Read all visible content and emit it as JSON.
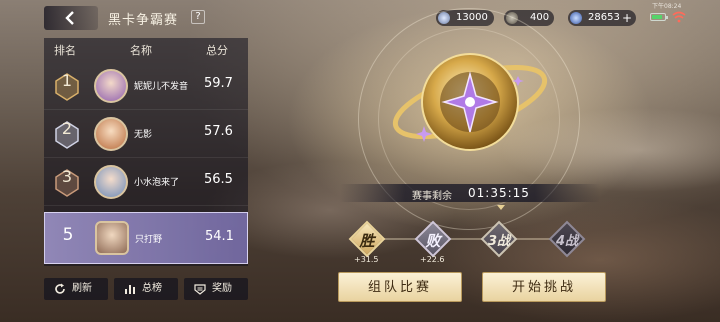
{
  "header": {
    "title": "黑卡争霸赛",
    "help": "?"
  },
  "currencies": [
    {
      "icon": "gem-icon",
      "value": "13000"
    },
    {
      "icon": "card-icon",
      "value": "400"
    },
    {
      "icon": "coin-icon",
      "value": "28653",
      "plus": "+"
    }
  ],
  "status": {
    "time": "下午08:24"
  },
  "board": {
    "headers": {
      "rank": "排名",
      "name": "名称",
      "score": "总分"
    },
    "rows": [
      {
        "rank": "1",
        "name": "妮妮儿不发音",
        "score": "59.7",
        "self": false
      },
      {
        "rank": "2",
        "name": "无影",
        "score": "57.6",
        "self": false
      },
      {
        "rank": "3",
        "name": "小水泡来了",
        "score": "56.5",
        "self": false
      },
      {
        "rank": "5",
        "name": "只打野",
        "score": "54.1",
        "self": true
      }
    ],
    "buttons": {
      "refresh": "刷新",
      "ranking": "总榜",
      "reward": "奖励"
    }
  },
  "timer": {
    "label": "赛事剩余",
    "value": "01:35:15"
  },
  "matches": [
    {
      "label": "胜",
      "points": "+31.5",
      "state": "win"
    },
    {
      "label": "败",
      "points": "+22.6",
      "state": "lose"
    },
    {
      "label": "3战",
      "points": "",
      "state": "pending"
    },
    {
      "label": "4战",
      "points": "",
      "state": "locked"
    }
  ],
  "actions": {
    "team": "组队比赛",
    "challenge": "开始挑战"
  },
  "colors": {
    "accent": "#e9d39a",
    "self_row": "#968cbe",
    "button": "#f4e4bb"
  }
}
